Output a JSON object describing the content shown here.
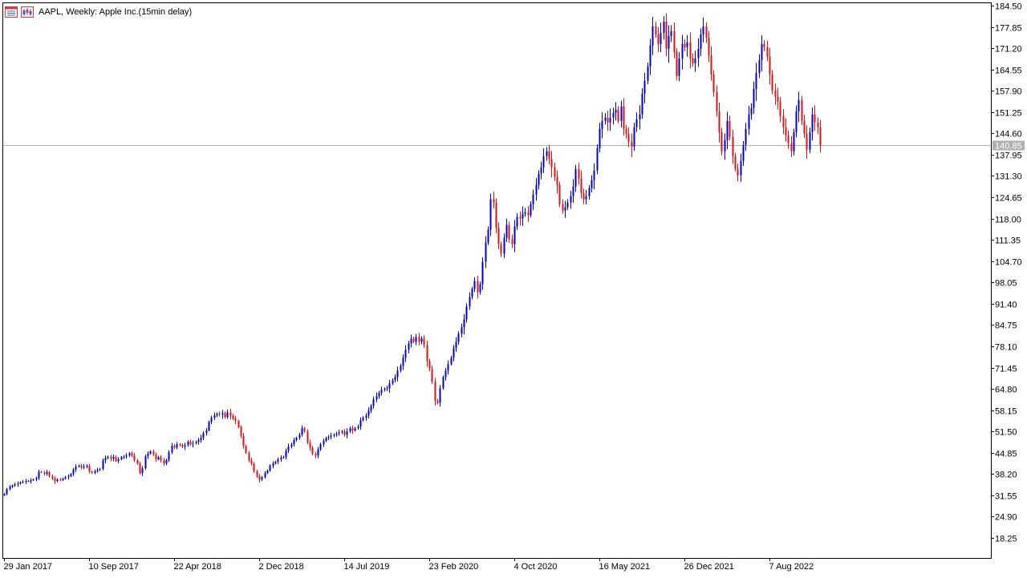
{
  "header": {
    "title": "AAPL, Weekly:  Apple Inc.(15min delay)",
    "icons": [
      "menu-list-icon",
      "chart-type-icon"
    ]
  },
  "colors": {
    "bull": "#0000cc",
    "bear": "#dd1111",
    "axis": "#000000",
    "price_line": "#b0b0b0",
    "price_label_bg": "#b0b0b0",
    "price_label_text": "#ffffff"
  },
  "chart_data": {
    "type": "candlestick",
    "symbol": "AAPL",
    "timeframe": "Weekly",
    "y_ticks": [
      184.5,
      177.85,
      171.2,
      164.55,
      157.9,
      151.25,
      144.6,
      137.95,
      131.3,
      124.65,
      118.0,
      111.35,
      104.7,
      98.05,
      91.4,
      84.75,
      78.1,
      71.45,
      64.8,
      58.15,
      51.5,
      44.85,
      38.2,
      31.55,
      24.9,
      18.25
    ],
    "x_ticks": [
      "29 Jan 2017",
      "10 Sep 2017",
      "22 Apr 2018",
      "2 Dec 2018",
      "14 Jul 2019",
      "23 Feb 2020",
      "4 Oct 2020",
      "16 May 2021",
      "26 Dec 2021",
      "7 Aug 2022"
    ],
    "current_price": 140.85,
    "current_price_label": "140.85",
    "ylim": [
      12.0,
      185.5
    ],
    "bars_between_x_ticks": 32,
    "closes": [
      32.0,
      33.5,
      34.2,
      34.6,
      35.0,
      35.2,
      35.6,
      35.8,
      36.0,
      35.9,
      36.3,
      36.5,
      37.0,
      38.9,
      38.7,
      38.3,
      38.8,
      37.5,
      36.8,
      36.0,
      36.5,
      36.3,
      36.8,
      37.2,
      37.5,
      38.2,
      39.6,
      40.5,
      40.8,
      40.3,
      40.5,
      40.8,
      39.0,
      38.6,
      39.1,
      39.5,
      39.8,
      42.5,
      43.2,
      43.6,
      43.0,
      43.5,
      42.3,
      42.8,
      43.5,
      43.6,
      44.0,
      44.7,
      44.0,
      42.5,
      41.5,
      38.5,
      40.0,
      43.8,
      44.6,
      45.3,
      44.2,
      42.8,
      43.5,
      42.5,
      41.5,
      42.6,
      45.0,
      47.0,
      46.5,
      47.5,
      47.2,
      46.8,
      47.2,
      48.3,
      47.5,
      47.8,
      48.2,
      48.8,
      49.5,
      51.0,
      51.8,
      54.5,
      55.8,
      56.5,
      57.0,
      56.8,
      57.2,
      56.0,
      57.5,
      56.4,
      55.5,
      54.8,
      52.8,
      50.2,
      47.0,
      44.8,
      42.5,
      41.5,
      39.0,
      37.5,
      36.5,
      37.2,
      38.5,
      39.3,
      40.8,
      41.5,
      42.0,
      42.8,
      43.3,
      43.5,
      45.5,
      46.8,
      47.5,
      48.8,
      49.5,
      50.5,
      52.5,
      51.5,
      48.0,
      46.5,
      44.5,
      44.0,
      45.8,
      47.5,
      48.5,
      49.5,
      49.8,
      50.2,
      50.5,
      50.8,
      51.2,
      51.5,
      50.5,
      51.5,
      52.5,
      51.8,
      52.5,
      53.0,
      55.0,
      55.8,
      56.5,
      58.0,
      59.5,
      61.5,
      62.5,
      63.5,
      64.5,
      64.8,
      65.0,
      66.5,
      67.5,
      68.5,
      70.5,
      72.0,
      74.5,
      77.0,
      79.0,
      80.5,
      79.5,
      81.0,
      79.5,
      80.5,
      78.5,
      73.5,
      71.0,
      67.0,
      61.0,
      60.5,
      65.0,
      68.5,
      70.5,
      72.5,
      74.5,
      77.5,
      79.5,
      82.0,
      84.0,
      86.5,
      90.5,
      93.5,
      96.0,
      98.5,
      95.0,
      97.5,
      104.5,
      110.5,
      114.5,
      124.0,
      123.0,
      115.0,
      110.0,
      107.0,
      112.0,
      116.0,
      111.5,
      110.0,
      115.5,
      118.5,
      118.0,
      119.5,
      120.0,
      119.0,
      122.5,
      125.5,
      128.5,
      132.0,
      134.0,
      137.5,
      139.0,
      136.5,
      134.0,
      131.0,
      128.5,
      122.5,
      120.5,
      121.5,
      123.0,
      125.0,
      128.0,
      133.5,
      130.5,
      126.0,
      124.0,
      125.0,
      127.5,
      130.0,
      133.0,
      140.0,
      146.0,
      148.5,
      149.5,
      148.0,
      149.5,
      151.0,
      152.0,
      148.5,
      153.0,
      146.0,
      144.5,
      142.0,
      140.5,
      146.5,
      149.0,
      150.5,
      157.0,
      161.0,
      165.5,
      172.0,
      178.0,
      175.5,
      172.5,
      176.0,
      179.5,
      171.0,
      175.0,
      176.5,
      170.0,
      162.5,
      168.0,
      172.5,
      171.5,
      173.0,
      168.0,
      166.5,
      168.0,
      171.0,
      175.5,
      178.0,
      174.5,
      169.0,
      163.0,
      157.5,
      151.5,
      145.0,
      139.0,
      142.5,
      148.5,
      143.5,
      137.5,
      133.5,
      131.5,
      136.0,
      141.0,
      146.0,
      150.5,
      152.5,
      158.5,
      163.5,
      167.5,
      172.5,
      171.5,
      168.5,
      163.0,
      158.0,
      156.0,
      154.5,
      150.0,
      146.5,
      144.0,
      141.5,
      139.0,
      145.0,
      151.5,
      155.0,
      148.5,
      144.5,
      139.5,
      145.0,
      150.5,
      148.0,
      146.5,
      140.85
    ]
  }
}
